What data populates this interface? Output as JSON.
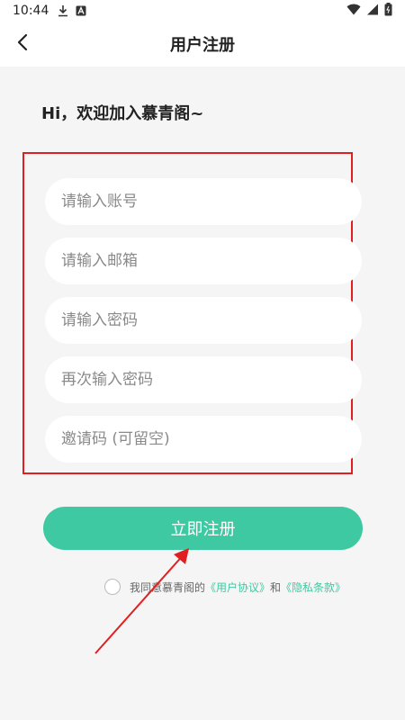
{
  "status_bar": {
    "time": "10:44",
    "icons": [
      "download-icon",
      "a-badge-icon",
      "wifi-icon",
      "signal-icon",
      "battery-icon"
    ]
  },
  "navbar": {
    "title": "用户注册",
    "back_icon": "chevron-left-icon"
  },
  "greeting": "Hi，欢迎加入慕青阁~",
  "form": {
    "fields": [
      {
        "placeholder": "请输入账号",
        "value": ""
      },
      {
        "placeholder": "请输入邮箱",
        "value": ""
      },
      {
        "placeholder": "请输入密码",
        "value": ""
      },
      {
        "placeholder": "再次输入密码",
        "value": ""
      },
      {
        "placeholder": "邀请码 (可留空)",
        "value": ""
      }
    ],
    "submit_label": "立即注册"
  },
  "agreement": {
    "prefix": "我同意慕青阁的",
    "user_agreement": "《用户协议》",
    "and": "和",
    "privacy_policy": "《隐私条款》",
    "checked": false
  },
  "colors": {
    "accent": "#3ec9a2",
    "annotation": "#e02020",
    "background": "#f5f5f5"
  }
}
